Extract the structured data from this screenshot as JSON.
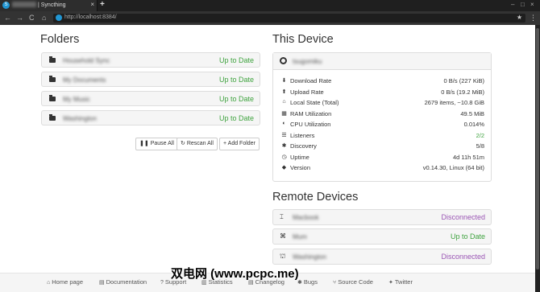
{
  "browser": {
    "tab_title": "| Syncthing",
    "tab_close": "×",
    "new_tab": "+",
    "url": "http://localhost:8384/",
    "nav_back": "←",
    "nav_forward": "→",
    "nav_reload": "C",
    "nav_home": "⌂",
    "star": "★",
    "menu": "⋮",
    "win_min": "–",
    "win_max": "□",
    "win_close": "×"
  },
  "folders": {
    "title": "Folders",
    "items": [
      {
        "name": "Household Sync",
        "status": "Up to Date"
      },
      {
        "name": "My Documents",
        "status": "Up to Date"
      },
      {
        "name": "My Music",
        "status": "Up to Date"
      },
      {
        "name": "Washington",
        "status": "Up to Date"
      }
    ],
    "buttons": {
      "pause_all": "Pause All",
      "rescan_all": "Rescan All",
      "add_folder": "+ Add Folder"
    }
  },
  "this_device": {
    "title": "This Device",
    "name": "tsugomiku",
    "stats": [
      {
        "icon": "download-icon",
        "glyph": "⬇",
        "label": "Download Rate",
        "value": "0 B/s (227 KiB)"
      },
      {
        "icon": "upload-icon",
        "glyph": "⬆",
        "label": "Upload Rate",
        "value": "0 B/s (19.2 MiB)"
      },
      {
        "icon": "home-icon",
        "glyph": "⌂",
        "label": "Local State (Total)",
        "value": "2679 items, ~10.8 GiB"
      },
      {
        "icon": "ram-icon",
        "glyph": "▦",
        "label": "RAM Utilization",
        "value": "49.5 MiB"
      },
      {
        "icon": "cpu-icon",
        "glyph": "◐",
        "label": "CPU Utilization",
        "value": "0.014%"
      },
      {
        "icon": "listeners-icon",
        "glyph": "☰",
        "label": "Listeners",
        "value": "2/2"
      },
      {
        "icon": "discovery-icon",
        "glyph": "✱",
        "label": "Discovery",
        "value": "5/8"
      },
      {
        "icon": "uptime-icon",
        "glyph": "◷",
        "label": "Uptime",
        "value": "4d 11h 51m"
      },
      {
        "icon": "version-icon",
        "glyph": "◆",
        "label": "Version",
        "value": "v0.14.30, Linux (64 bit)"
      }
    ]
  },
  "remote_devices": {
    "title": "Remote Devices",
    "items": [
      {
        "name": "Macbook",
        "status": "Disconnected",
        "glyph": "⌶"
      },
      {
        "name": "Mum",
        "status": "Up to Date",
        "glyph": "⌘"
      },
      {
        "name": "Washington",
        "status": "Disconnected",
        "glyph": "⛫"
      }
    ]
  },
  "footer": {
    "links": [
      {
        "label": "Home page",
        "glyph": "⌂"
      },
      {
        "label": "Documentation",
        "glyph": "▤"
      },
      {
        "label": "Support",
        "glyph": "?"
      },
      {
        "label": "Statistics",
        "glyph": "▥"
      },
      {
        "label": "Changelog",
        "glyph": "▤"
      },
      {
        "label": "Bugs",
        "glyph": "✱"
      },
      {
        "label": "Source Code",
        "glyph": "⑂"
      },
      {
        "label": "Twitter",
        "glyph": "✦"
      }
    ]
  },
  "watermark": "双电网 (www.pcpc.me)",
  "colors": {
    "up_to_date": "#3fa33f",
    "disconnected": "#9a55b4",
    "brand": "#2196d3"
  }
}
